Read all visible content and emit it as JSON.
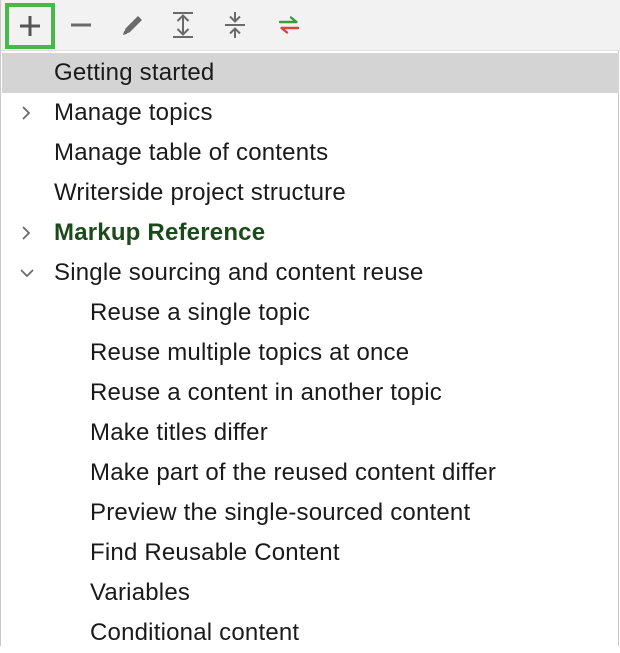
{
  "toolbar": {
    "buttons": [
      {
        "name": "add",
        "icon": "plus-icon"
      },
      {
        "name": "remove",
        "icon": "minus-icon"
      },
      {
        "name": "edit",
        "icon": "pencil-icon"
      },
      {
        "name": "expand-all",
        "icon": "expand-all-icon"
      },
      {
        "name": "collapse-all",
        "icon": "collapse-all-icon"
      },
      {
        "name": "swap",
        "icon": "swap-arrows-icon"
      }
    ],
    "highlight_color": "#49b84b",
    "swap_colors": {
      "top": "#3c9a3f",
      "bottom": "#d9453a"
    }
  },
  "tree": {
    "items": [
      {
        "label": "Getting started",
        "level": 0,
        "selected": true
      },
      {
        "label": "Manage topics",
        "level": 0,
        "expandable": true,
        "expanded": false
      },
      {
        "label": "Manage table of contents",
        "level": 0
      },
      {
        "label": "Writerside project structure",
        "level": 0
      },
      {
        "label": "Markup Reference",
        "level": 0,
        "expandable": true,
        "expanded": false,
        "bold": true
      },
      {
        "label": "Single sourcing and content reuse",
        "level": 0,
        "expandable": true,
        "expanded": true
      },
      {
        "label": "Reuse a single topic",
        "level": 1
      },
      {
        "label": "Reuse multiple topics at once",
        "level": 1
      },
      {
        "label": "Reuse a content in another topic",
        "level": 1
      },
      {
        "label": "Make titles differ",
        "level": 1
      },
      {
        "label": "Make part of the reused content differ",
        "level": 1
      },
      {
        "label": "Preview the single-sourced content",
        "level": 1
      },
      {
        "label": "Find Reusable Content",
        "level": 1
      },
      {
        "label": "Variables",
        "level": 1
      },
      {
        "label": "Conditional content",
        "level": 1
      }
    ],
    "selected_color": "#d4d4d4",
    "bold_color": "#1d4a1b"
  }
}
